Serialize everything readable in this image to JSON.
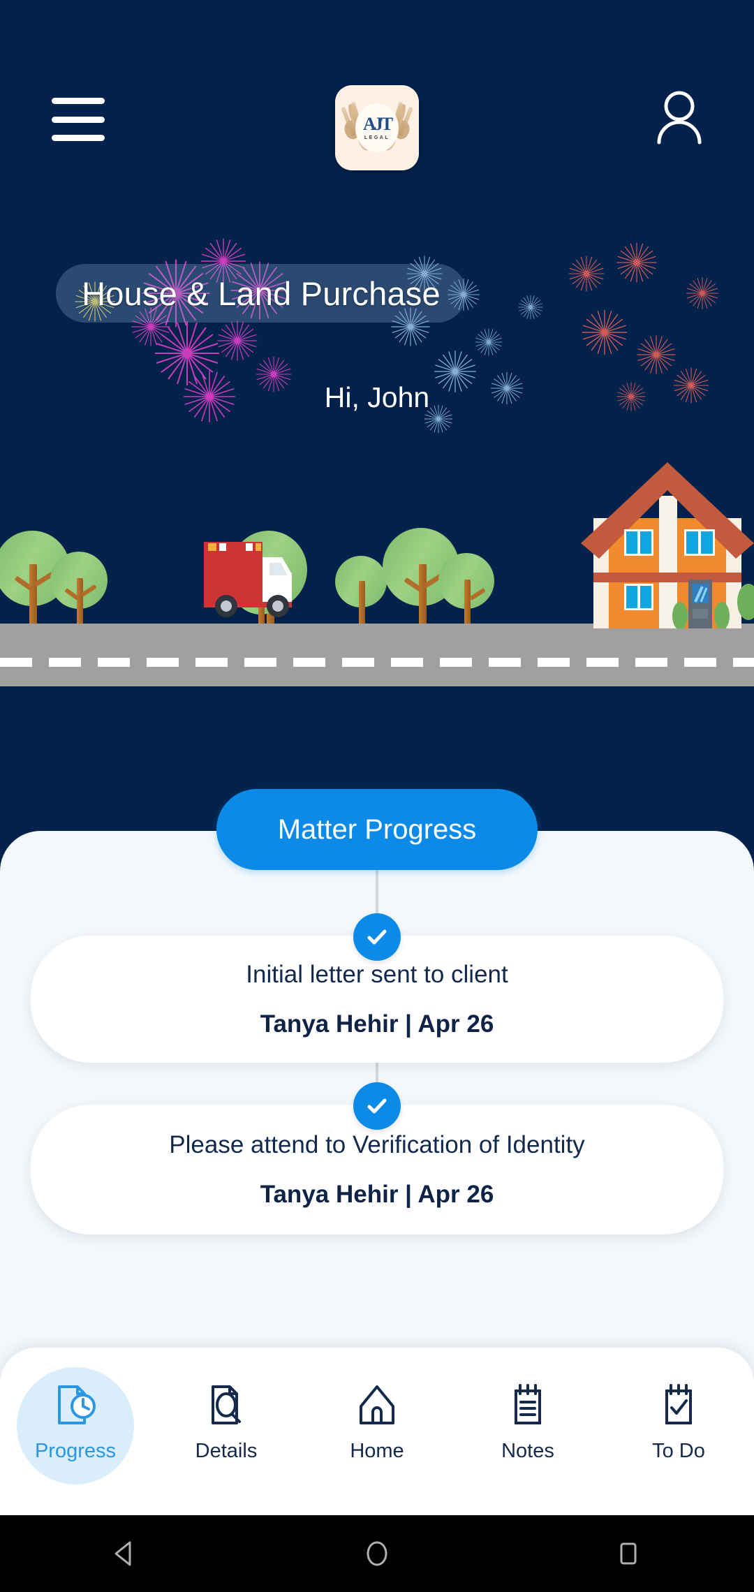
{
  "appbar": {
    "menu_icon": "hamburger-menu-icon",
    "logo_mark": "AJT",
    "logo_subtitle": "LEGAL",
    "profile_icon": "user-profile-icon"
  },
  "hero": {
    "matter_title": "House & Land Purchase",
    "greeting": "Hi, John",
    "background_color": "#02224b",
    "title_pill_color": "rgba(140,170,205,0.30)"
  },
  "progress": {
    "header_label": "Matter Progress",
    "header_color": "#0b8ae8",
    "sheet_color": "#f4f8fb",
    "steps": [
      {
        "title": "Initial letter sent to client",
        "meta": "Tanya Hehir |  Apr 26",
        "status_icon": "check-icon",
        "completed": true
      },
      {
        "title": "Please attend to Verification of Identity",
        "meta": "Tanya Hehir |  Apr 26",
        "status_icon": "check-icon",
        "completed": true
      }
    ]
  },
  "tabbar": {
    "active_index": 0,
    "active_color": "#2b96e4",
    "inactive_color": "#14294c",
    "items": [
      {
        "label": "Progress",
        "icon": "document-clock-icon"
      },
      {
        "label": "Details",
        "icon": "document-search-icon"
      },
      {
        "label": "Home",
        "icon": "home-icon"
      },
      {
        "label": "Notes",
        "icon": "notepad-lines-icon"
      },
      {
        "label": "To Do",
        "icon": "notepad-check-icon"
      }
    ]
  },
  "androidnav": {
    "back": "back-triangle-icon",
    "home": "home-circle-icon",
    "recents": "recents-square-icon"
  },
  "illustration": {
    "house_wall_color": "#f08a2c",
    "roof_color": "#c25a3d",
    "window_color": "#12a5e0",
    "tree_color": "#8ecb77",
    "truck_body_color": "#cf3434",
    "road_color": "#a0a0a0"
  }
}
